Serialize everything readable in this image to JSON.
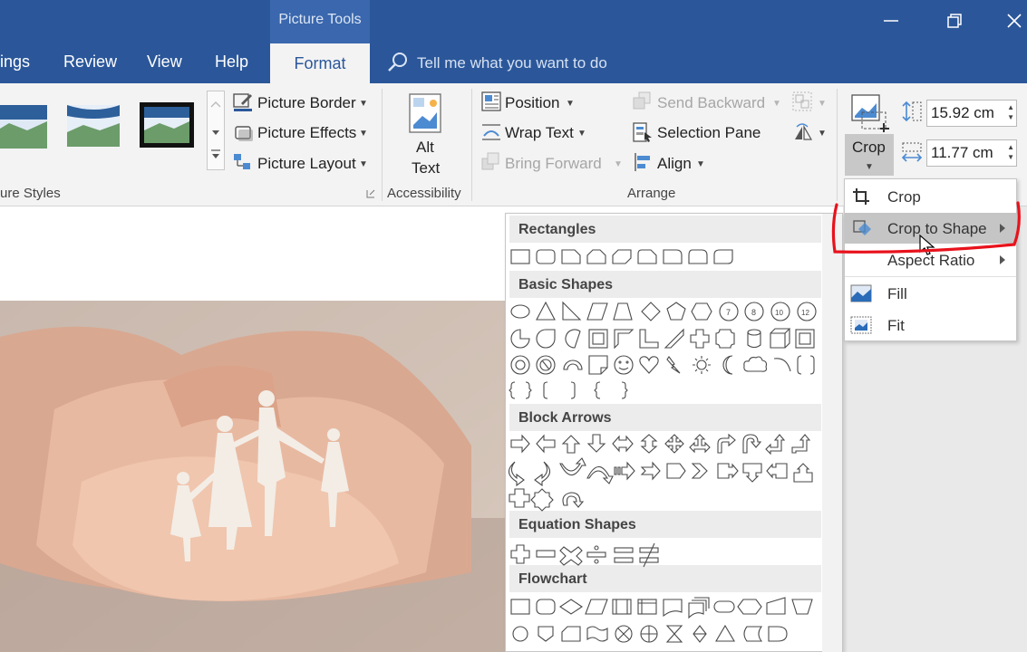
{
  "title_bar": {
    "context_group": "Picture Tools",
    "tabs": [
      "ings",
      "Review",
      "View",
      "Help",
      "Format"
    ],
    "active_tab": "Format",
    "tell_me": "Tell me what you want to do"
  },
  "ribbon": {
    "picture_styles": {
      "border_label": "Picture Border",
      "effects_label": "Picture Effects",
      "layout_label": "Picture Layout",
      "group_label": "ure Styles"
    },
    "accessibility": {
      "alt_text_line1": "Alt",
      "alt_text_line2": "Text",
      "group_label": "Accessibility"
    },
    "arrange": {
      "position_label": "Position",
      "wrap_text_label": "Wrap Text",
      "bring_forward_label": "Bring Forward",
      "send_backward_label": "Send Backward",
      "selection_pane_label": "Selection Pane",
      "align_label": "Align",
      "group_label": "Arrange"
    },
    "size": {
      "crop_label": "Crop",
      "height_value": "15.92 cm",
      "width_value": "11.77 cm"
    }
  },
  "crop_menu": {
    "items": [
      "Crop",
      "Crop to Shape",
      "Aspect Ratio",
      "Fill",
      "Fit"
    ],
    "highlighted": "Crop to Shape"
  },
  "shape_gallery": {
    "categories": [
      "Rectangles",
      "Basic Shapes",
      "Block Arrows",
      "Equation Shapes",
      "Flowchart"
    ]
  },
  "annotation_color": "#e8121c"
}
